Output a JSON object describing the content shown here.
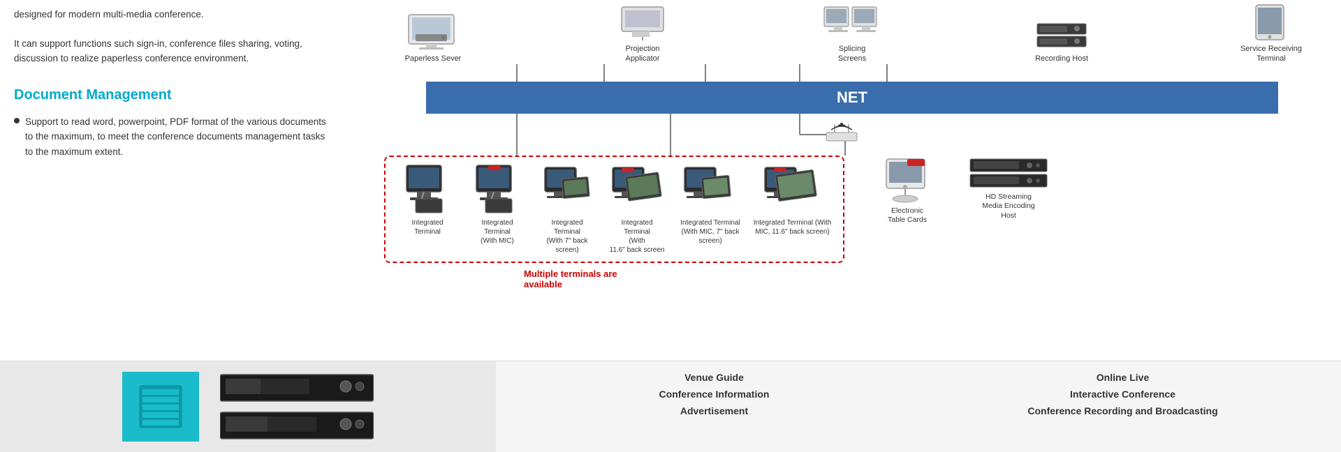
{
  "leftPanel": {
    "introText": "designed for modern multi-media conference.",
    "introText2": "It can support functions such sign-in, conference files sharing, voting, discussion to realize paperless conference environment.",
    "docManagementTitle": "Document Management",
    "bulletText": "Support to read word, powerpoint, PDF format of the various documents to the maximum, to meet the conference documents management tasks to the maximum extent."
  },
  "diagram": {
    "netLabel": "NET",
    "topDevices": [
      {
        "id": "paperless-server",
        "label": "Paperless Sever"
      },
      {
        "id": "projection-applicator",
        "label": "Projection\nApplicator"
      },
      {
        "id": "splicing-screens",
        "label": "Splicing\nScreens"
      },
      {
        "id": "recording-host",
        "label": "Recording Host"
      },
      {
        "id": "service-terminal",
        "label": "Service Receiving\nTerminal"
      }
    ],
    "terminals": [
      {
        "id": "integrated-terminal",
        "label": "Integrated\nTerminal"
      },
      {
        "id": "integrated-terminal-mic",
        "label": "Integrated\nTerminal\n(With MIC)"
      },
      {
        "id": "integrated-terminal-7back",
        "label": "Integrated\nTerminal\n(With 7\" back\nscreen)"
      },
      {
        "id": "integrated-terminal-116back",
        "label": "Integrated\nTerminal\n(With\n11.6\" back screen"
      },
      {
        "id": "integrated-terminal-mic-7back",
        "label": "Integrated Terminal\n(With MIC, 7\" back\nscreen)"
      },
      {
        "id": "integrated-terminal-mic-116back",
        "label": "Integrated Terminal (With\nMIC, 11.6\" back screen)"
      }
    ],
    "multipleTerminalsText": "Multiple terminals are\navailable",
    "rightDevices": [
      {
        "id": "electronic-table-cards",
        "label": "Electronic\nTable Cards"
      },
      {
        "id": "hd-streaming",
        "label": "HD Streaming\nMedia Encoding\nHost"
      },
      {
        "id": "wifi-router",
        "label": ""
      }
    ]
  },
  "footer": {
    "items1": [
      {
        "label": "Venue Guide"
      },
      {
        "label": "Conference Information"
      },
      {
        "label": "Advertisement"
      }
    ],
    "items2": [
      {
        "label": "Online Live"
      },
      {
        "label": "Interactive Conference"
      },
      {
        "label": "Conference Recording and Broadcasting"
      }
    ]
  }
}
